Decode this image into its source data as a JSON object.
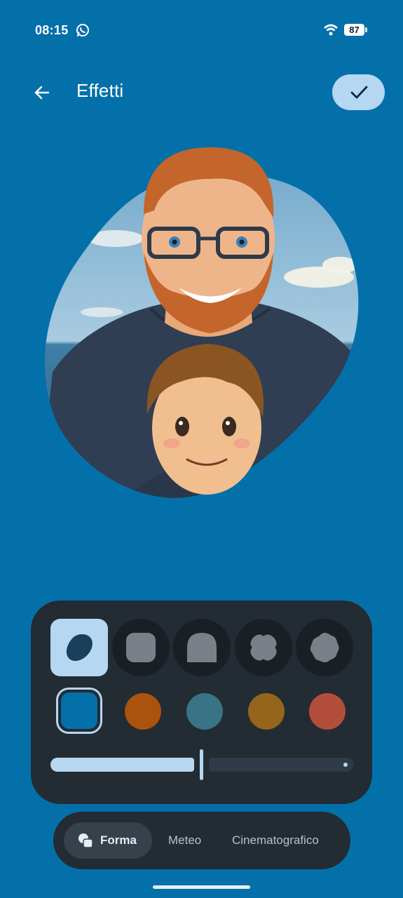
{
  "status_bar": {
    "time": "08:15",
    "notification_icon": "whatsapp-icon",
    "wifi_icon": "wifi-icon",
    "battery_level": "87"
  },
  "header": {
    "back_icon": "arrow-back-icon",
    "title": "Effetti",
    "confirm_icon": "check-icon"
  },
  "preview": {
    "description_icon": "profile-photo-preview"
  },
  "shapes": [
    {
      "name": "blob",
      "selected": true
    },
    {
      "name": "rounded-square",
      "selected": false
    },
    {
      "name": "arch",
      "selected": false
    },
    {
      "name": "clover",
      "selected": false
    },
    {
      "name": "wavy-circle",
      "selected": false
    }
  ],
  "colors": [
    {
      "hex": "#0470aa",
      "selected": true
    },
    {
      "hex": "#a9530f",
      "selected": false
    },
    {
      "hex": "#3a7385",
      "selected": false
    },
    {
      "hex": "#94651a",
      "selected": false
    },
    {
      "hex": "#b34e3a",
      "selected": false
    }
  ],
  "slider": {
    "value": 0.5
  },
  "tabs": [
    {
      "label": "Forma",
      "active": true
    },
    {
      "label": "Meteo",
      "active": false
    },
    {
      "label": "Cinematografico",
      "active": false
    }
  ],
  "theme": {
    "background": "#0470aa",
    "panel": "#232b33",
    "accent": "#b5d7f1"
  }
}
